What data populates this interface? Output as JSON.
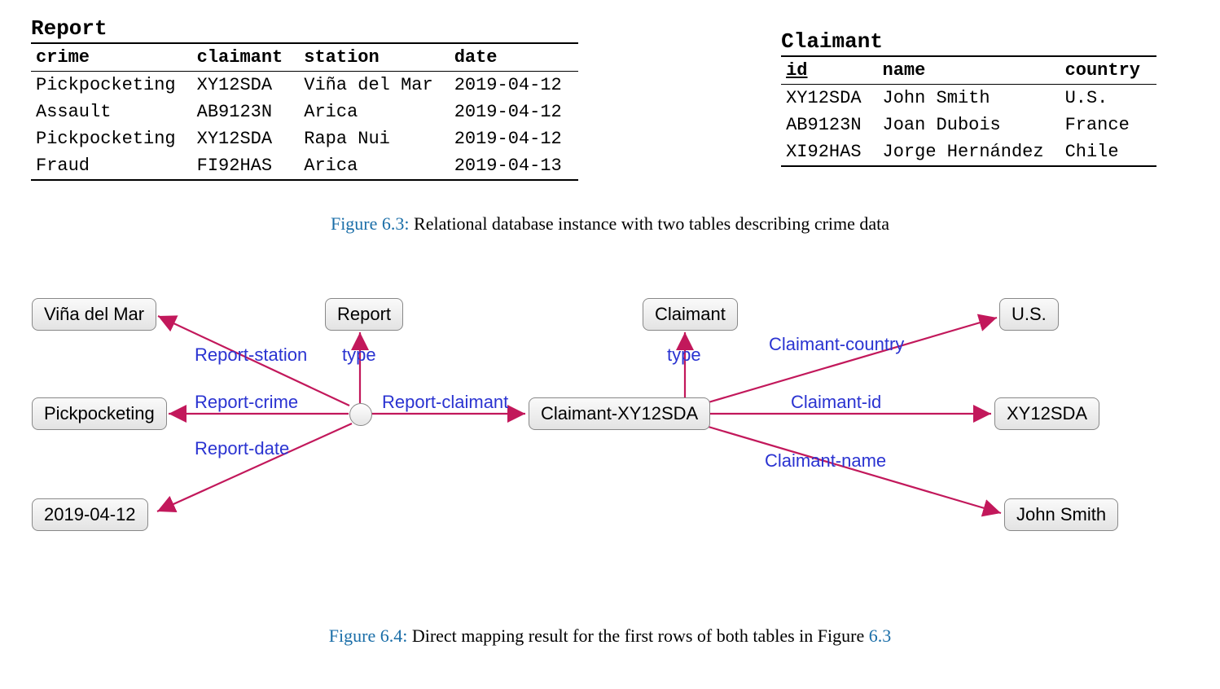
{
  "tables": {
    "report": {
      "title": "Report",
      "headers": {
        "crime": "crime",
        "claimant": "claimant",
        "station": "station",
        "date": "date"
      },
      "rows": [
        {
          "crime": "Pickpocketing",
          "claimant": "XY12SDA",
          "station": "Viña del Mar",
          "date": "2019-04-12"
        },
        {
          "crime": "Assault",
          "claimant": "AB9123N",
          "station": "Arica",
          "date": "2019-04-12"
        },
        {
          "crime": "Pickpocketing",
          "claimant": "XY12SDA",
          "station": "Rapa Nui",
          "date": "2019-04-12"
        },
        {
          "crime": "Fraud",
          "claimant": "FI92HAS",
          "station": "Arica",
          "date": "2019-04-13"
        }
      ]
    },
    "claimant": {
      "title": "Claimant",
      "headers": {
        "id": "id",
        "name": "name",
        "country": "country"
      },
      "rows": [
        {
          "id": "XY12SDA",
          "name": "John Smith",
          "country": "U.S."
        },
        {
          "id": "AB9123N",
          "name": "Joan Dubois",
          "country": "France"
        },
        {
          "id": "XI92HAS",
          "name": "Jorge Hernández",
          "country": "Chile"
        }
      ]
    }
  },
  "captions": {
    "fig63": {
      "no": "Figure 6.3:",
      "text": " Relational database instance with two tables describing crime data"
    },
    "fig64": {
      "no": "Figure 6.4:",
      "text_a": " Direct mapping result for the first rows of both tables in Figure ",
      "link": "6.3"
    }
  },
  "graph": {
    "nodes": {
      "vina": "Viña del Mar",
      "pick": "Pickpocketing",
      "date": "2019-04-12",
      "reportT": "Report",
      "claimantT": "Claimant",
      "cx": "Claimant-XY12SDA",
      "us": "U.S.",
      "xid": "XY12SDA",
      "john": "John Smith"
    },
    "edges": {
      "station": "Report-station",
      "crime": "Report-crime",
      "rdate": "Report-date",
      "rtype": "type",
      "rclaim": "Report-claimant",
      "ctype": "type",
      "ccountry": "Claimant-country",
      "cid": "Claimant-id",
      "cname": "Claimant-name"
    }
  }
}
